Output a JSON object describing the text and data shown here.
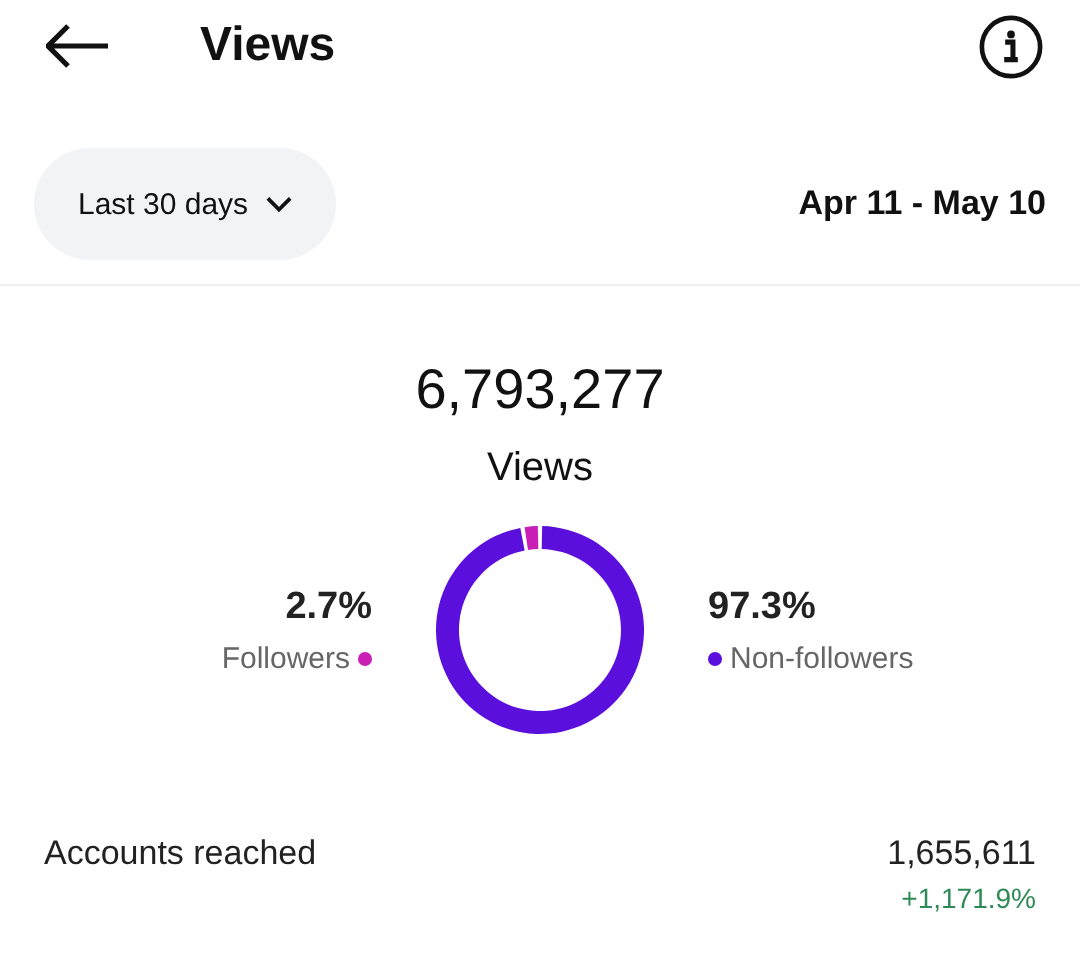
{
  "header": {
    "title": "Views"
  },
  "filter": {
    "label": "Last 30 days",
    "date_range": "Apr 11 - May 10"
  },
  "summary": {
    "total": "6,793,277",
    "label": "Views"
  },
  "audience": {
    "legend": [
      {
        "value": "2.7%",
        "color": "#c91fb5"
      },
      {
        "value": "97.3%",
        "color": "#5b0fdc"
      }
    ],
    "chart_data": {
      "type": "donut",
      "categories": [
        "Followers",
        "Non-followers"
      ],
      "series": [
        {
          "values": [
            2.7,
            97.3
          ]
        }
      ]
    }
  },
  "metrics": [
    {
      "label": "Accounts reached",
      "value": "1,655,611",
      "change": "+1,171.9%"
    }
  ]
}
